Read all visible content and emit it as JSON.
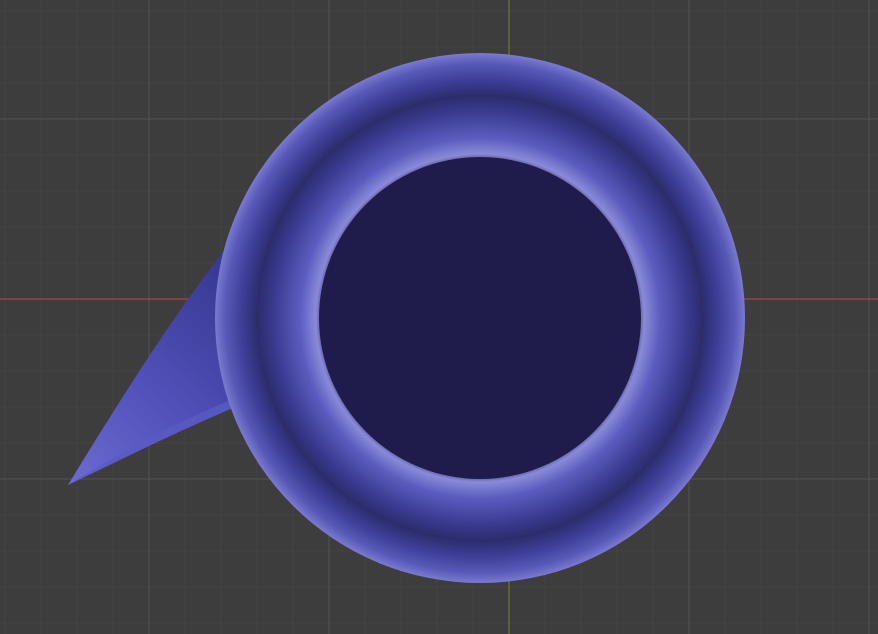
{
  "viewport": {
    "background_color": "#3d3d3d",
    "grid": {
      "visible": true,
      "minor_color": "#444444",
      "major_color": "#525252"
    },
    "axes": {
      "x_axis_color": "#c0484f",
      "y_axis_color": "#6e8b2c"
    }
  },
  "object": {
    "shape": "speech-bubble",
    "body_color": "#4747a8",
    "highlight_color": "#8f8fe0",
    "shadow_color": "#28285e",
    "inner_color": "#1f1c4c"
  }
}
